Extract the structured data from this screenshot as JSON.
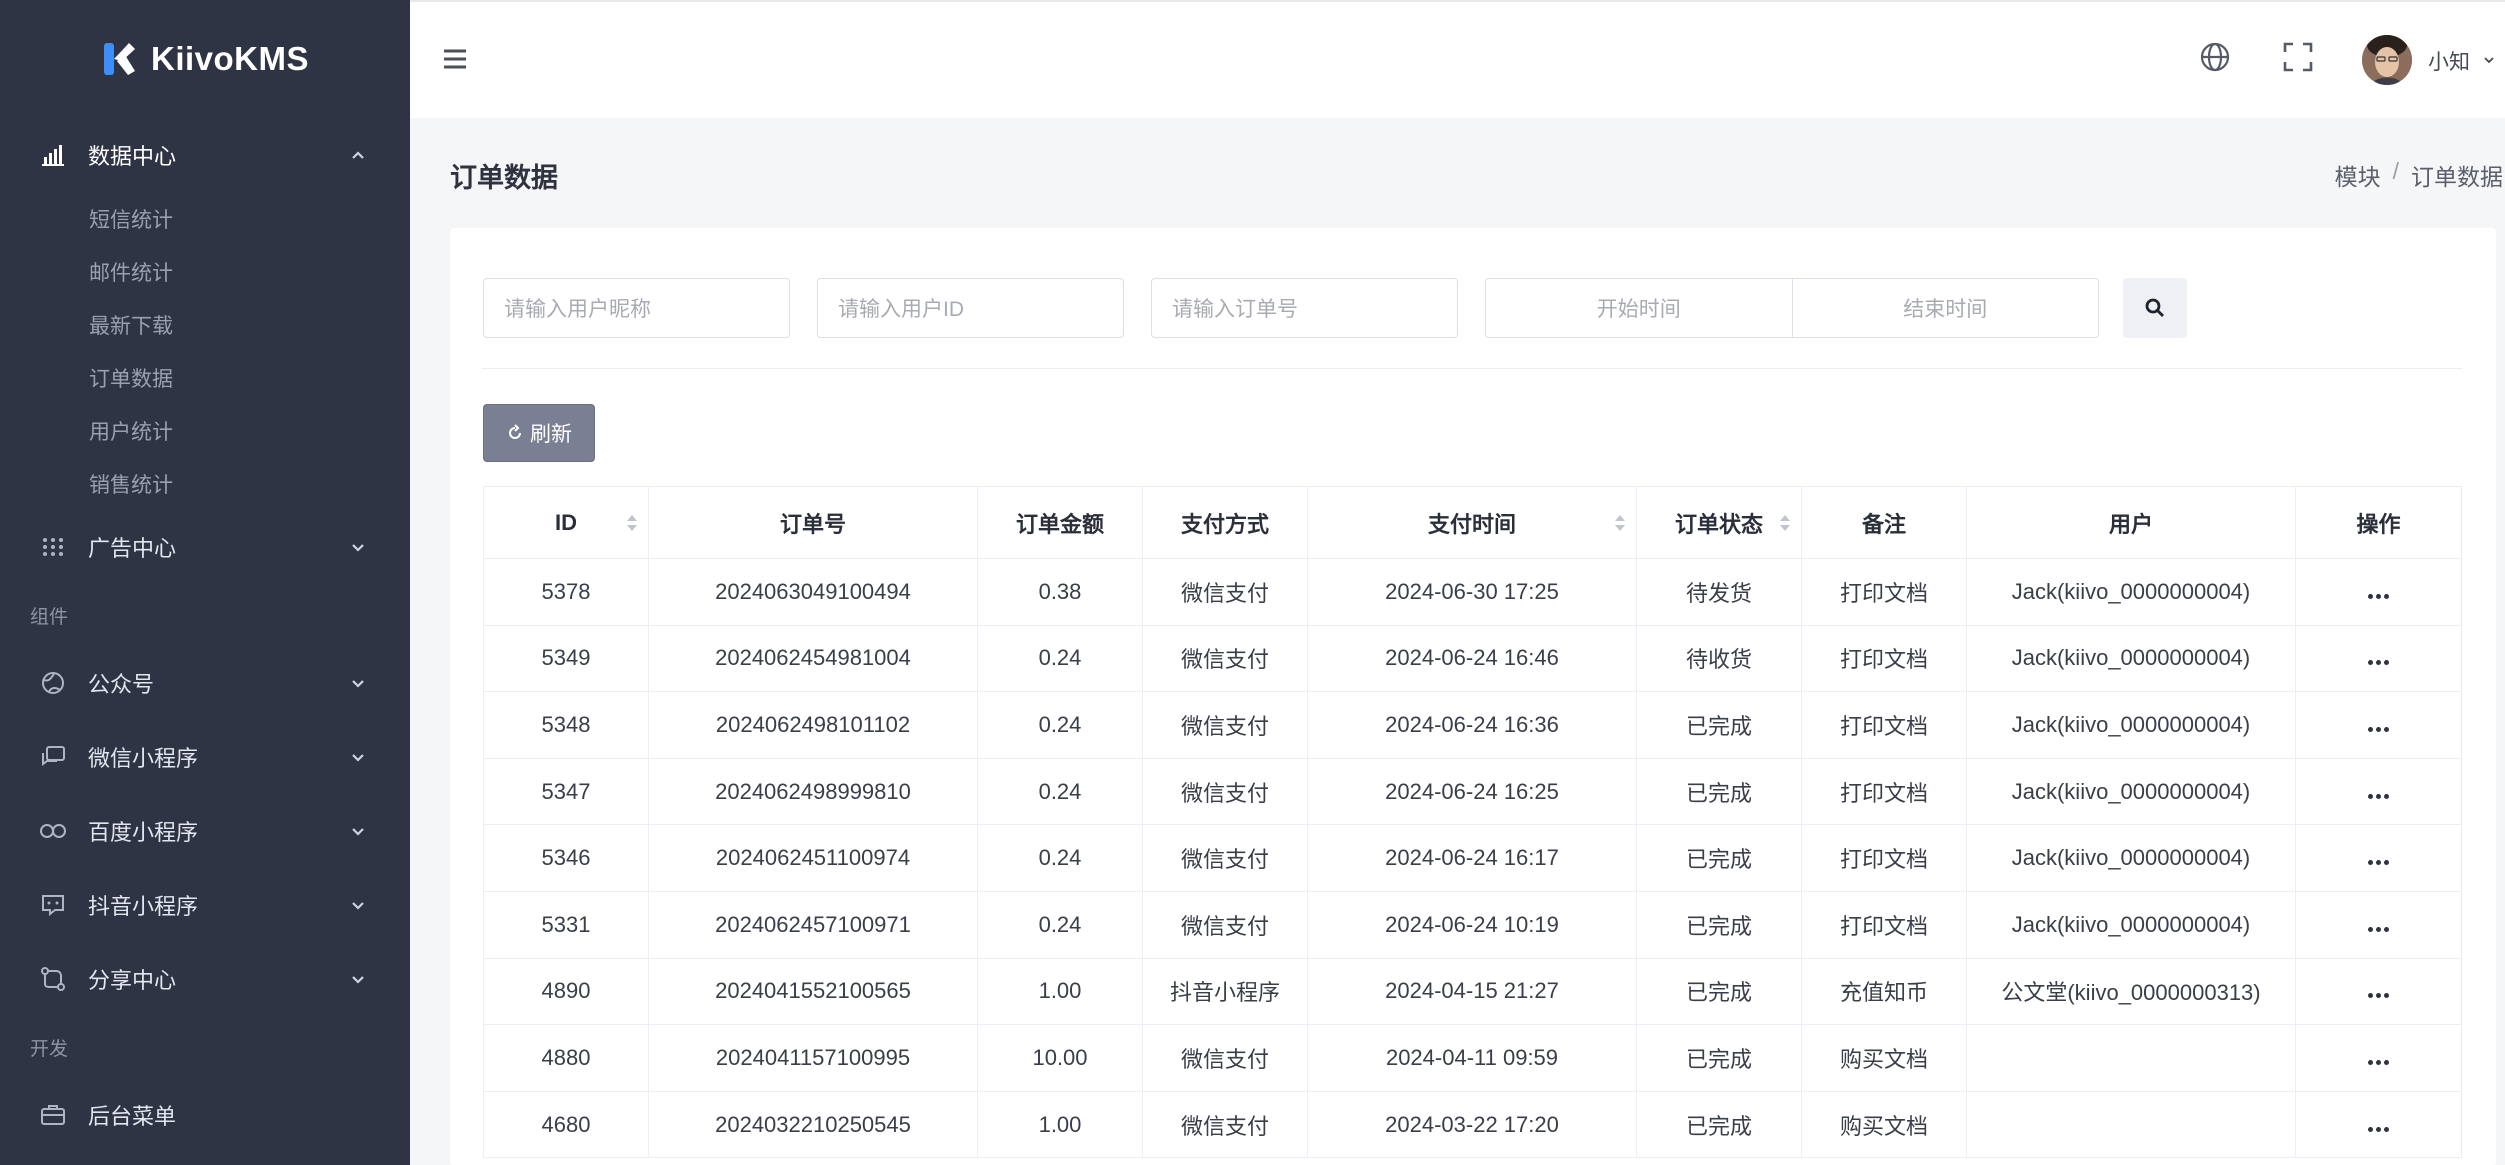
{
  "app": {
    "brand": "KiivoKMS"
  },
  "sidebar": {
    "groups": [
      {
        "type": "menu",
        "label": "数据中心",
        "icon": "bar-chart-icon",
        "expanded": true,
        "children": [
          "短信统计",
          "邮件统计",
          "最新下载",
          "订单数据",
          "用户统计",
          "销售统计"
        ]
      },
      {
        "type": "menu",
        "label": "广告中心",
        "icon": "grid-dots-icon",
        "expanded": false
      }
    ],
    "section_components": "组件",
    "component_items": [
      {
        "label": "公众号",
        "icon": "globe-icon"
      },
      {
        "label": "微信小程序",
        "icon": "chat-bubble-icon"
      },
      {
        "label": "百度小程序",
        "icon": "infinity-icon"
      },
      {
        "label": "抖音小程序",
        "icon": "message-square-icon"
      },
      {
        "label": "分享中心",
        "icon": "share-route-icon"
      }
    ],
    "section_dev": "开发",
    "dev_items": [
      {
        "label": "后台菜单",
        "icon": "briefcase-icon"
      }
    ]
  },
  "header": {
    "username": "小知"
  },
  "page": {
    "title": "订单数据",
    "breadcrumb": [
      "模块",
      "订单数据"
    ]
  },
  "filters": {
    "nickname_placeholder": "请输入用户昵称",
    "userid_placeholder": "请输入用户ID",
    "order_placeholder": "请输入订单号",
    "start_placeholder": "开始时间",
    "end_placeholder": "结束时间"
  },
  "toolbar": {
    "refresh_label": "刷新"
  },
  "table": {
    "columns": [
      "ID",
      "订单号",
      "订单金额",
      "支付方式",
      "支付时间",
      "订单状态",
      "备注",
      "用户",
      "操作"
    ],
    "rows": [
      [
        "5378",
        "2024063049100494",
        "0.38",
        "微信支付",
        "2024-06-30 17:25",
        "待发货",
        "打印文档",
        "Jack(kiivo_0000000004)"
      ],
      [
        "5349",
        "2024062454981004",
        "0.24",
        "微信支付",
        "2024-06-24 16:46",
        "待收货",
        "打印文档",
        "Jack(kiivo_0000000004)"
      ],
      [
        "5348",
        "2024062498101102",
        "0.24",
        "微信支付",
        "2024-06-24 16:36",
        "已完成",
        "打印文档",
        "Jack(kiivo_0000000004)"
      ],
      [
        "5347",
        "2024062498999810",
        "0.24",
        "微信支付",
        "2024-06-24 16:25",
        "已完成",
        "打印文档",
        "Jack(kiivo_0000000004)"
      ],
      [
        "5346",
        "2024062451100974",
        "0.24",
        "微信支付",
        "2024-06-24 16:17",
        "已完成",
        "打印文档",
        "Jack(kiivo_0000000004)"
      ],
      [
        "5331",
        "2024062457100971",
        "0.24",
        "微信支付",
        "2024-06-24 10:19",
        "已完成",
        "打印文档",
        "Jack(kiivo_0000000004)"
      ],
      [
        "4890",
        "2024041552100565",
        "1.00",
        "抖音小程序",
        "2024-04-15 21:27",
        "已完成",
        "充值知币",
        "公文堂(kiivo_0000000313)"
      ],
      [
        "4880",
        "2024041157100995",
        "10.00",
        "微信支付",
        "2024-04-11 09:59",
        "已完成",
        "购买文档",
        ""
      ],
      [
        "4680",
        "2024032210250545",
        "1.00",
        "微信支付",
        "2024-03-22 17:20",
        "已完成",
        "购买文档",
        ""
      ]
    ]
  }
}
